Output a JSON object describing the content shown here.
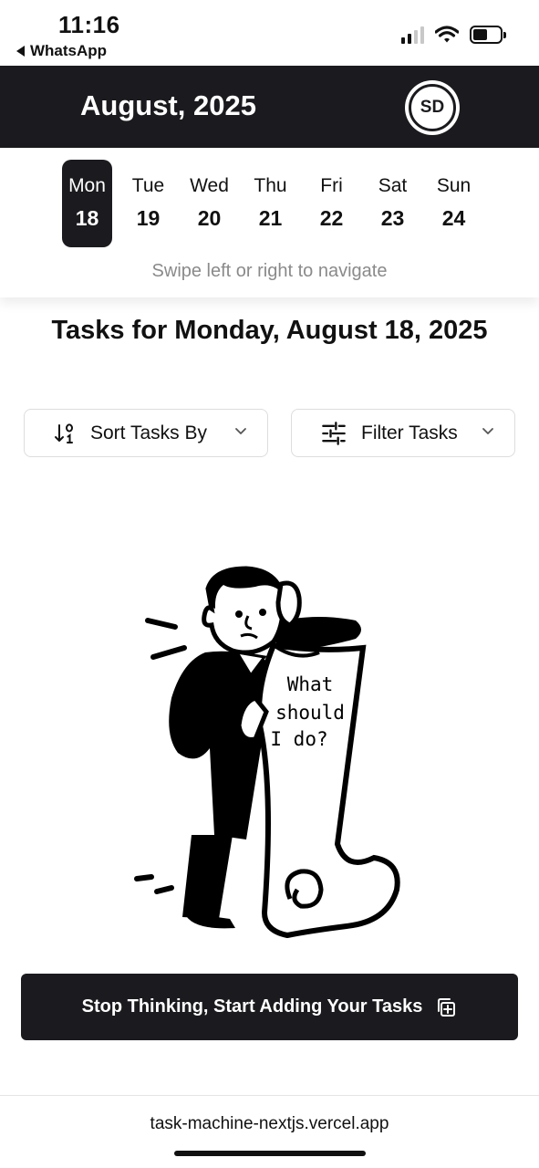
{
  "status_bar": {
    "time": "11:16",
    "back_app": "WhatsApp",
    "battery_level": 0.55,
    "signal_bars": 2
  },
  "header": {
    "month": "August, 2025",
    "avatar_initials": "SD"
  },
  "week": {
    "days": [
      {
        "name": "Mon",
        "num": "18",
        "selected": true
      },
      {
        "name": "Tue",
        "num": "19",
        "selected": false
      },
      {
        "name": "Wed",
        "num": "20",
        "selected": false
      },
      {
        "name": "Thu",
        "num": "21",
        "selected": false
      },
      {
        "name": "Fri",
        "num": "22",
        "selected": false
      },
      {
        "name": "Sat",
        "num": "23",
        "selected": false
      },
      {
        "name": "Sun",
        "num": "24",
        "selected": false
      }
    ],
    "hint": "Swipe left or right to navigate"
  },
  "tasks": {
    "title": "Tasks for Monday, August 18, 2025",
    "sort_label": "Sort Tasks By",
    "filter_label": "Filter Tasks",
    "empty_scroll_text": [
      "What",
      "should",
      "I do?"
    ]
  },
  "cta": {
    "label": "Stop Thinking, Start Adding Your Tasks"
  },
  "browser": {
    "url": "task-machine-nextjs.vercel.app"
  },
  "colors": {
    "dark": "#1b1b1f",
    "muted": "#8a8a8a"
  },
  "icons": {
    "sort": "sort-numeric-icon",
    "filter": "sliders-icon",
    "chevron": "chevron-down-icon",
    "cta": "add-copy-icon"
  }
}
